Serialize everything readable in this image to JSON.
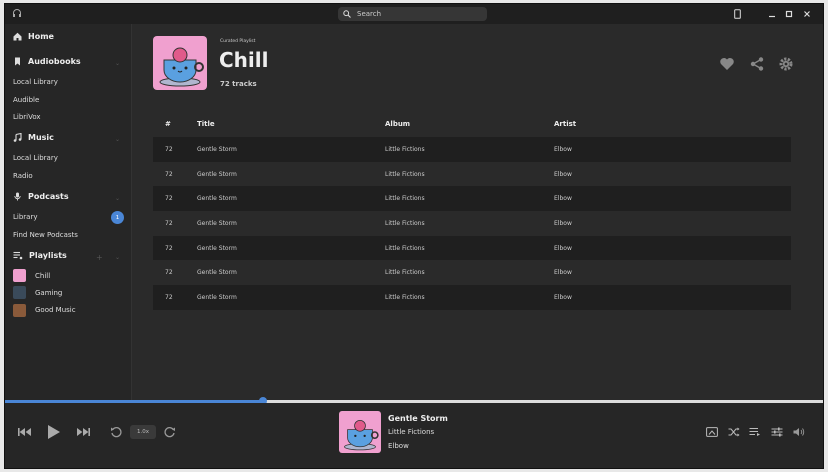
{
  "titlebar": {
    "search_placeholder": "Search"
  },
  "sidebar": {
    "home": "Home",
    "audiobooks": {
      "label": "Audiobooks",
      "items": [
        "Local Library",
        "Audible",
        "LibriVox"
      ]
    },
    "music": {
      "label": "Music",
      "items": [
        "Local Library",
        "Radio"
      ]
    },
    "podcasts": {
      "label": "Podcasts",
      "items": [
        "Library",
        "Find New Podcasts"
      ],
      "library_badge": "1"
    },
    "playlists": {
      "label": "Playlists",
      "items": [
        "Chill",
        "Gaming",
        "Good Music"
      ]
    }
  },
  "playlist": {
    "subtitle": "Curated Playlist",
    "title": "Chill",
    "tracks": "72 tracks",
    "columns": [
      "#",
      "Title",
      "Album",
      "Artist"
    ],
    "rows": [
      {
        "num": "72",
        "title": "Gentle Storm",
        "album": "Little Fictions",
        "artist": "Elbow"
      },
      {
        "num": "72",
        "title": "Gentle Storm",
        "album": "Little Fictions",
        "artist": "Elbow"
      },
      {
        "num": "72",
        "title": "Gentle Storm",
        "album": "Little Fictions",
        "artist": "Elbow"
      },
      {
        "num": "72",
        "title": "Gentle Storm",
        "album": "Little Fictions",
        "artist": "Elbow"
      },
      {
        "num": "72",
        "title": "Gentle Storm",
        "album": "Little Fictions",
        "artist": "Elbow"
      },
      {
        "num": "72",
        "title": "Gentle Storm",
        "album": "Little Fictions",
        "artist": "Elbow"
      },
      {
        "num": "72",
        "title": "Gentle Storm",
        "album": "Little Fictions",
        "artist": "Elbow"
      }
    ]
  },
  "player": {
    "speed": "1.0x",
    "progress_percent": 31.5,
    "now_playing": {
      "title": "Gentle Storm",
      "album": "Little Fictions",
      "artist": "Elbow"
    }
  },
  "colors": {
    "accent": "#4a86d6",
    "cover_bg": "#f0a0cf"
  }
}
